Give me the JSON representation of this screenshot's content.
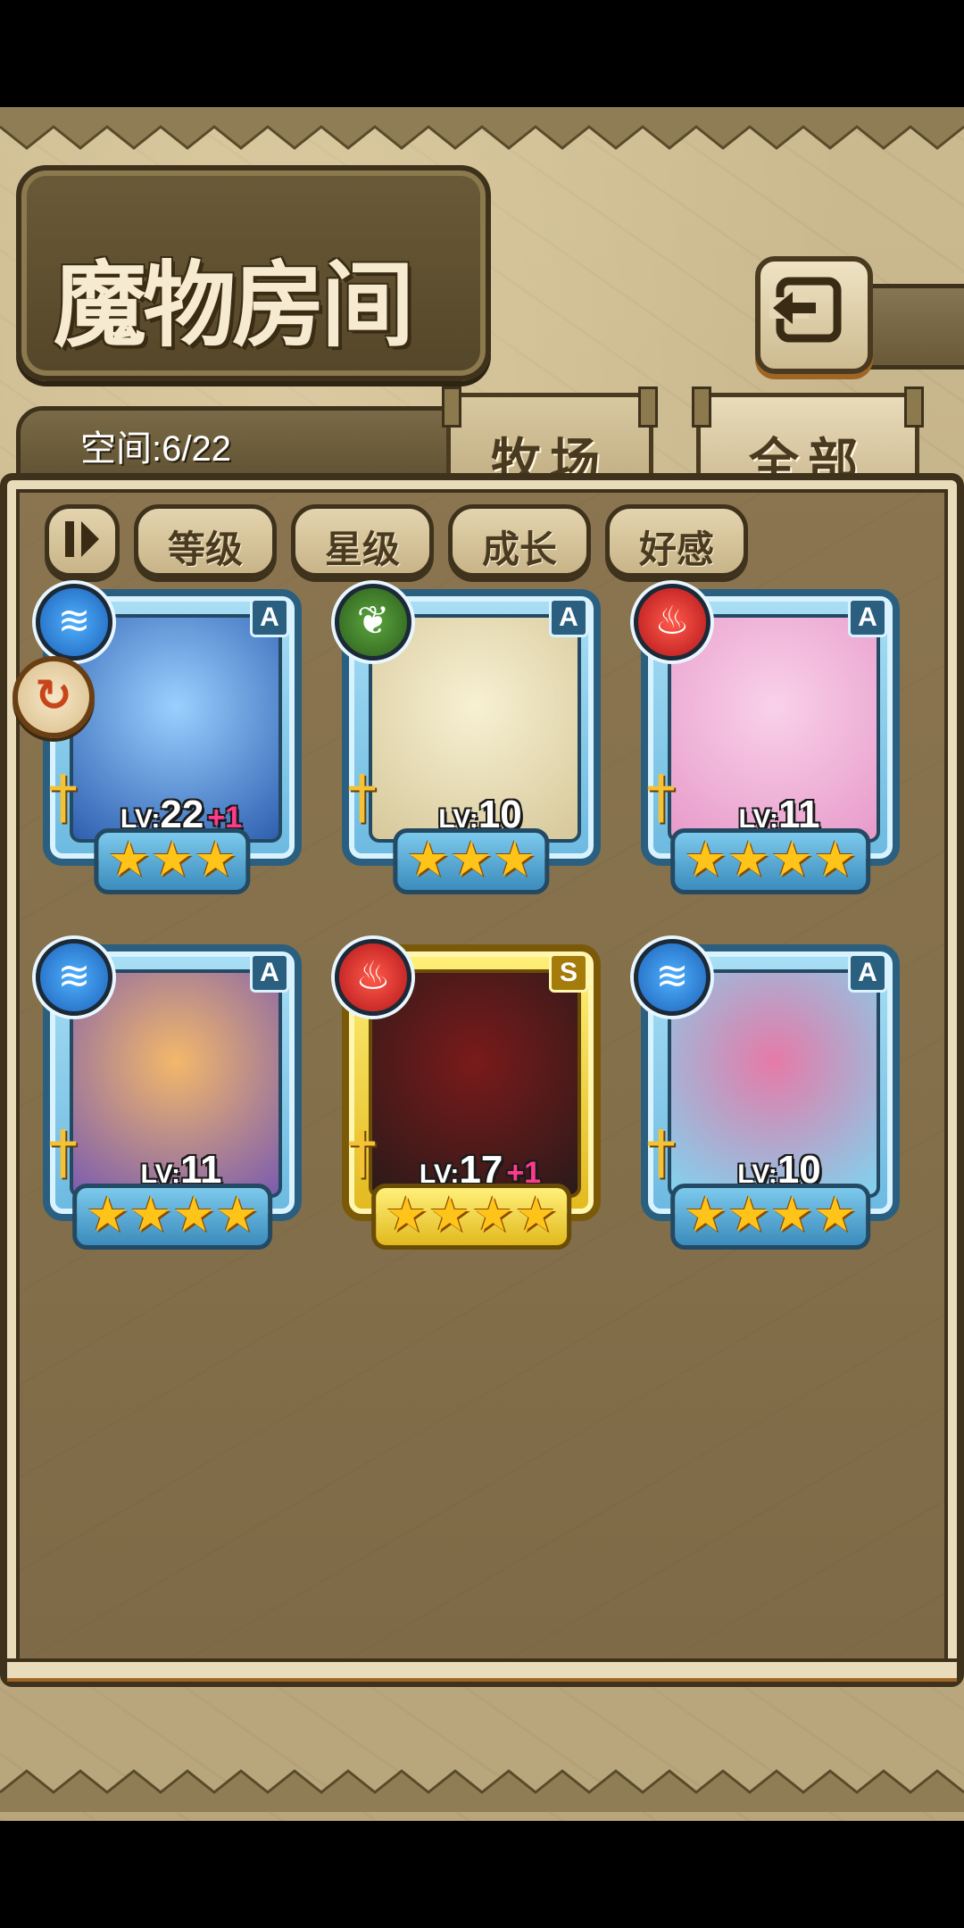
{
  "header": {
    "title": "魔物房间"
  },
  "storage": {
    "space_text": "空间:6/22"
  },
  "tabs": [
    {
      "label": "牧场",
      "active": true
    },
    {
      "label": "全部",
      "active": false
    }
  ],
  "sort_buttons": [
    {
      "label": "等级"
    },
    {
      "label": "星级"
    },
    {
      "label": "成长"
    },
    {
      "label": "好感"
    }
  ],
  "monsters": [
    {
      "element": "water",
      "rank": "A",
      "level": "22",
      "bonus": "+1",
      "stars": 3,
      "portrait_colors": [
        "#2e5fb0",
        "#9ad0ff"
      ]
    },
    {
      "element": "wood",
      "rank": "A",
      "level": "10",
      "bonus": "",
      "stars": 3,
      "portrait_colors": [
        "#d6c89a",
        "#f7f0d2"
      ]
    },
    {
      "element": "fire",
      "rank": "A",
      "level": "11",
      "bonus": "",
      "stars": 4,
      "portrait_colors": [
        "#e79ac9",
        "#f9d1ea"
      ]
    },
    {
      "element": "water",
      "rank": "A",
      "level": "11",
      "bonus": "",
      "stars": 4,
      "portrait_colors": [
        "#7a5bb0",
        "#f3b86a"
      ]
    },
    {
      "element": "fire",
      "rank": "S",
      "level": "17",
      "bonus": "+1",
      "stars": 4,
      "portrait_colors": [
        "#2a1a1a",
        "#7a1a1a"
      ]
    },
    {
      "element": "water",
      "rank": "A",
      "level": "10",
      "bonus": "",
      "stars": 4,
      "portrait_colors": [
        "#7fd4f0",
        "#e67aa8"
      ]
    }
  ],
  "level_prefix": "LV:",
  "icons": {
    "back": "return-arrow-icon",
    "sort_order": "sort-order-icon",
    "pin": "pin-arrow-icon",
    "water": "water-element-icon",
    "wood": "wood-element-icon",
    "fire": "fire-element-icon",
    "sword": "sword-icon",
    "star": "star-icon"
  },
  "colors": {
    "accent_blue_frame": "#6cb9e0",
    "gold_frame": "#e2b91e",
    "parchment": "#cbb98f",
    "panel_brown": "#8a7550",
    "star": "#ffc41a",
    "bonus_pink": "#ff3a8c"
  }
}
